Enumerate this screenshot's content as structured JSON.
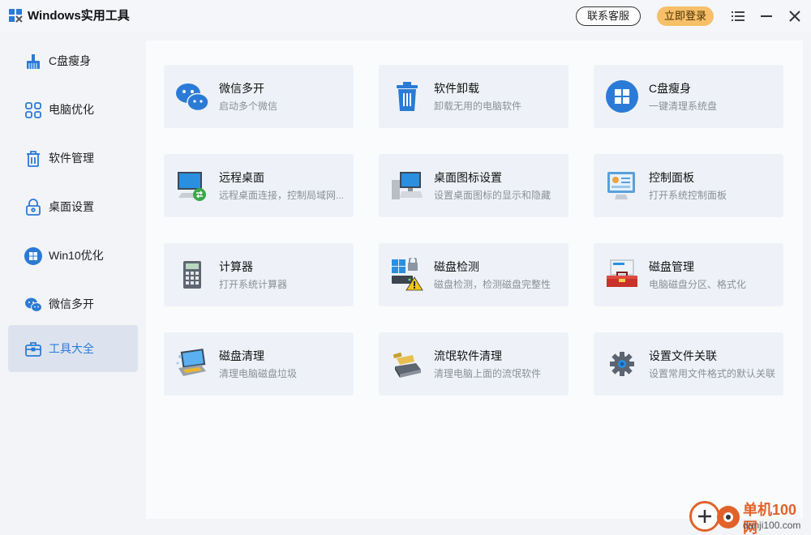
{
  "app": {
    "title": "Windows实用工具",
    "support_label": "联系客服",
    "login_label": "立即登录",
    "accent": "#2b7bd6",
    "login_color": "#f6bf68"
  },
  "sidebar": {
    "items": [
      {
        "label": "C盘瘦身",
        "icon": "broom-icon"
      },
      {
        "label": "电脑优化",
        "icon": "grid-icon"
      },
      {
        "label": "软件管理",
        "icon": "trash-icon"
      },
      {
        "label": "桌面设置",
        "icon": "lock-icon"
      },
      {
        "label": "Win10优化",
        "icon": "windows-icon"
      },
      {
        "label": "微信多开",
        "icon": "wechat-icon"
      },
      {
        "label": "工具大全",
        "icon": "toolbox-icon",
        "active": true
      }
    ]
  },
  "cards": [
    {
      "title": "微信多开",
      "desc": "启动多个微信",
      "icon": "wechat-icon"
    },
    {
      "title": "软件卸载",
      "desc": "卸载无用的电脑软件",
      "icon": "trash-icon"
    },
    {
      "title": "C盘瘦身",
      "desc": "一键清理系统盘",
      "icon": "windows-icon"
    },
    {
      "title": "远程桌面",
      "desc": "远程桌面连接，控制局域网...",
      "icon": "remote-desktop-icon"
    },
    {
      "title": "桌面图标设置",
      "desc": "设置桌面图标的显示和隐藏",
      "icon": "desktop-computer-icon"
    },
    {
      "title": "控制面板",
      "desc": "打开系统控制面板",
      "icon": "control-panel-icon"
    },
    {
      "title": "计算器",
      "desc": "打开系统计算器",
      "icon": "calculator-icon"
    },
    {
      "title": "磁盘检测",
      "desc": "磁盘检测，检测磁盘完整性",
      "icon": "disk-check-icon"
    },
    {
      "title": "磁盘管理",
      "desc": "电脑磁盘分区、格式化",
      "icon": "disk-manage-icon"
    },
    {
      "title": "磁盘清理",
      "desc": "清理电脑磁盘垃圾",
      "icon": "disk-cleanup-icon"
    },
    {
      "title": "流氓软件清理",
      "desc": "清理电脑上面的流氓软件",
      "icon": "drive-clean-icon"
    },
    {
      "title": "设置文件关联",
      "desc": "设置常用文件格式的默认关联",
      "icon": "gear-icon"
    }
  ],
  "watermark": {
    "line1": "单机100网",
    "line2": "danji100.com"
  }
}
